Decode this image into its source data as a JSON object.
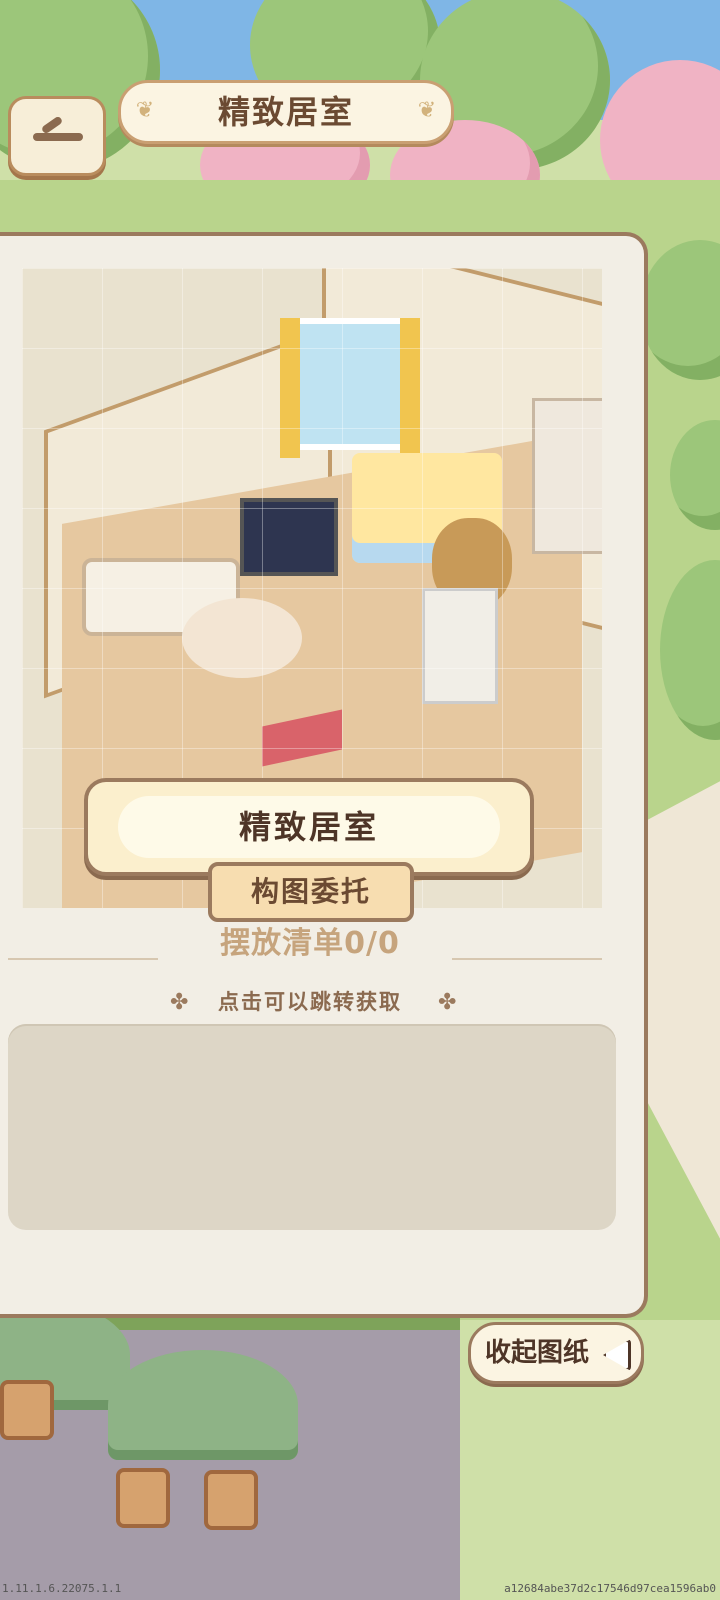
{
  "header": {
    "title": "精致居室"
  },
  "panel": {
    "room_name": "精致居室",
    "commission_tag": "构图委托",
    "placement_list_title": "摆放清单0/0",
    "hint": "点击可以跳转获取"
  },
  "actions": {
    "collapse_label": "收起图纸"
  },
  "footer": {
    "version": "1.11.1.6.22075.1.1",
    "hash": "a12684abe37d2c17546d97cea1596ab0"
  },
  "colors": {
    "panel_border": "#9b7a5e",
    "accent_text": "#6b4a32",
    "list_title": "#c6a47d"
  },
  "icons": [
    "back-arrow-icon",
    "leaf-ornament-icon",
    "clover-icon",
    "collapse-triangle-icon"
  ]
}
